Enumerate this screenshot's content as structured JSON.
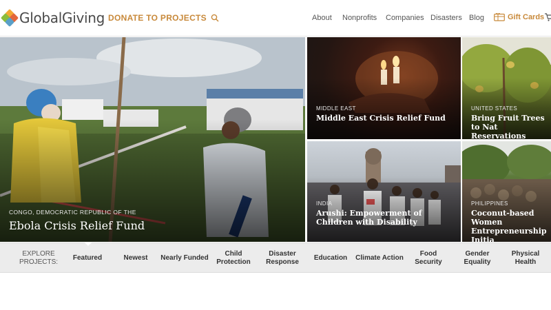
{
  "header": {
    "logo_text": "GlobalGiving",
    "donate_label": "DONATE TO PROJECTS",
    "nav": [
      "About",
      "Nonprofits",
      "Companies",
      "Disasters",
      "Blog"
    ],
    "gift_label": "Gift Cards"
  },
  "hero": {
    "main": {
      "country": "CONGO, DEMOCRATIC REPUBLIC OF THE",
      "title": "Ebola Crisis Relief Fund"
    },
    "tiles": [
      {
        "country": "MIDDLE EAST",
        "title": "Middle East Crisis Relief Fund"
      },
      {
        "country": "UNITED STATES",
        "title": "Bring Fruit Trees to Nat Reservations"
      },
      {
        "country": "INDIA",
        "title": "Arushi: Empowerment of Children with Disability"
      },
      {
        "country": "PHILIPPINES",
        "title": "Coconut-based Women Entrepreneurship Initia"
      }
    ]
  },
  "explore": {
    "label": "EXPLORE PROJECTS:",
    "categories": [
      "Featured",
      "Newest",
      "Nearly Funded",
      "Child Protection",
      "Disaster Response",
      "Education",
      "Climate Action",
      "Food Security",
      "Gender Equality",
      "Physical Health"
    ]
  },
  "colors": {
    "accent": "#c8893a",
    "explore_bg": "#ececec"
  }
}
